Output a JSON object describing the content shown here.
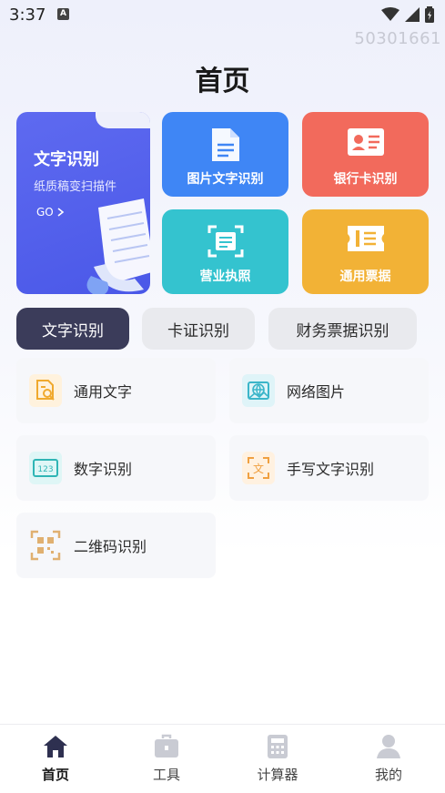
{
  "status": {
    "time": "3:37",
    "device_id": "50301661"
  },
  "page": {
    "title": "首页"
  },
  "hero": {
    "title": "文字识别",
    "subtitle": "纸质稿变扫描件",
    "go": "GO"
  },
  "tiles": [
    {
      "label": "图片文字识别",
      "color": "#3f86f5"
    },
    {
      "label": "银行卡识别",
      "color": "#f26a5c"
    },
    {
      "label": "营业执照",
      "color": "#34c3cf"
    },
    {
      "label": "通用票据",
      "color": "#f2b236"
    }
  ],
  "tabs": [
    {
      "label": "文字识别",
      "active": true
    },
    {
      "label": "卡证识别",
      "active": false
    },
    {
      "label": "财务票据识别",
      "active": false
    }
  ],
  "items": [
    {
      "label": "通用文字",
      "icon": "document-search-icon"
    },
    {
      "label": "网络图片",
      "icon": "web-image-icon"
    },
    {
      "label": "数字识别",
      "icon": "number-123-icon"
    },
    {
      "label": "手写文字识别",
      "icon": "handwriting-scan-icon"
    },
    {
      "label": "二维码识别",
      "icon": "qrcode-icon"
    }
  ],
  "nav": [
    {
      "label": "首页",
      "active": true
    },
    {
      "label": "工具",
      "active": false
    },
    {
      "label": "计算器",
      "active": false
    },
    {
      "label": "我的",
      "active": false
    }
  ],
  "colors": {
    "accent": "#3b3c5a",
    "hero": "#4f5ceb"
  }
}
